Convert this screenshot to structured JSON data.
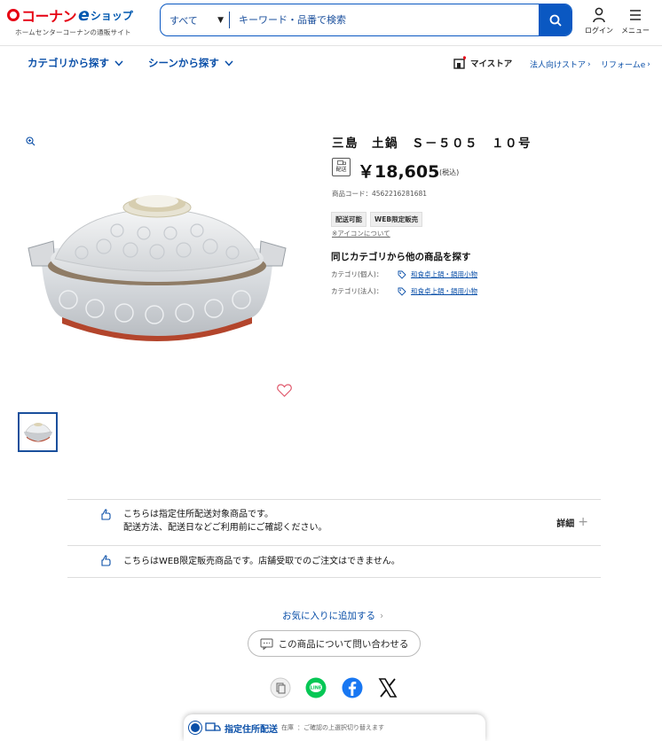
{
  "header": {
    "logo_main": "コーナン",
    "logo_e": "e",
    "logo_shop": "ショップ",
    "logo_sub": "ホームセンターコーナンの通販サイト",
    "search_category": "すべて",
    "search_placeholder": "キーワード・品番で検索",
    "login_label": "ログイン",
    "menu_label": "メニュー"
  },
  "subnav": {
    "category_label": "カテゴリから探す",
    "scene_label": "シーンから探す",
    "mystore_label": "マイストア",
    "corporate_label": "法人向けストア",
    "reform_label": "リフォームe"
  },
  "product": {
    "title": "三島　土鍋　Ｓ－５０５　１０号",
    "delivery_icon": "配送",
    "price": "￥18,605",
    "tax_note": "(税込)",
    "code": "商品コード：4562216281681",
    "badges": [
      "配送可能",
      "WEB限定販売"
    ],
    "icon_link": "※アイコンについて",
    "same_category_heading": "同じカテゴリから他の商品を探す",
    "categories": [
      {
        "label": "カテゴリ(個人)：",
        "value": "和食卓上鍋・鍋用小物"
      },
      {
        "label": "カテゴリ(法人)：",
        "value": "和食卓上鍋・鍋用小物"
      }
    ]
  },
  "notices": [
    {
      "line1": "こちらは指定住所配送対象商品です。",
      "line2": "配送方法、配送日などご利用前にご確認ください。",
      "detail_label": "詳細"
    },
    {
      "line1": "こちらはWEB限定販売商品です。店舗受取でのご注文はできません。"
    }
  ],
  "actions": {
    "favorite_label": "お気に入りに追加する",
    "inquiry_label": "この商品について問い合わせる"
  },
  "share_icons": [
    "copy-icon",
    "line-icon",
    "facebook-icon",
    "x-icon"
  ],
  "bottom_bar": {
    "title": "指定住所配送",
    "prefix": "在庫",
    "note": "：ご確認の上選択切り替えます"
  },
  "colors": {
    "brand_red": "#e60012",
    "brand_blue": "#0058b0",
    "link_blue": "#0a4fa8",
    "line_green": "#06c755",
    "facebook_blue": "#1877f2"
  }
}
